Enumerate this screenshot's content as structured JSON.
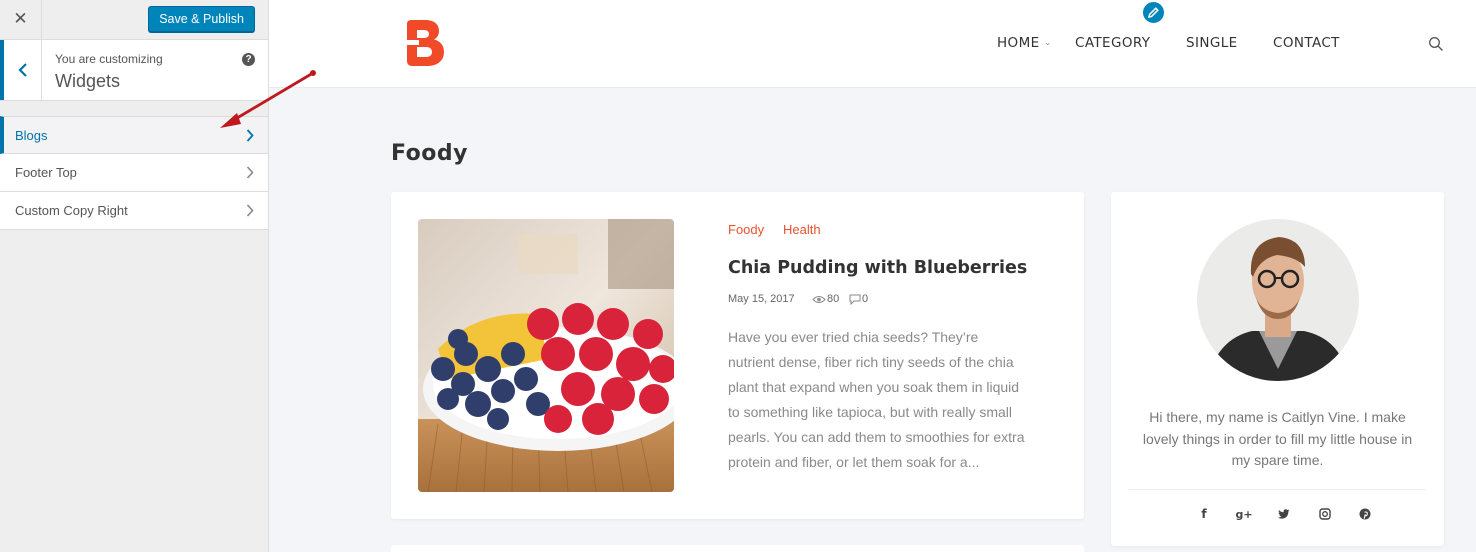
{
  "customizer": {
    "close_icon": "close-icon",
    "save_label": "Save & Publish",
    "context_label": "You are customizing",
    "panel_title": "Widgets",
    "help_icon": "help-icon",
    "help_glyph": "?",
    "items": [
      {
        "label": "Blogs",
        "active": true
      },
      {
        "label": "Footer Top",
        "active": false
      },
      {
        "label": "Custom Copy Right",
        "active": false
      }
    ],
    "accent_color": "#0073aa"
  },
  "site": {
    "logo_letter": "B",
    "brand_color": "#f04a29",
    "nav": {
      "home": "HOME",
      "category": "CATEGORY",
      "single": "SINGLE",
      "contact": "CONTACT"
    },
    "page_title": "Foody",
    "post": {
      "categories": [
        "Foody",
        "Health"
      ],
      "title": "Chia Pudding with Blueberries",
      "date": "May 15, 2017",
      "views": "80",
      "comments": "0",
      "excerpt": "Have you ever tried chia seeds? They’re nutrient dense, fiber rich tiny seeds of the chia plant that expand when you soak them in liquid to something like tapioca, but with really small pearls. You can add them to smoothies for extra protein and fiber, or let them soak for a..."
    },
    "widget": {
      "bio": "Hi there, my name is Caitlyn Vine. I make lovely things in order to fill my little house in my spare time.",
      "social": {
        "facebook": "f",
        "google_plus": "g+",
        "twitter": "twitter-icon",
        "instagram": "instagram-icon",
        "pinterest": "p"
      }
    }
  }
}
